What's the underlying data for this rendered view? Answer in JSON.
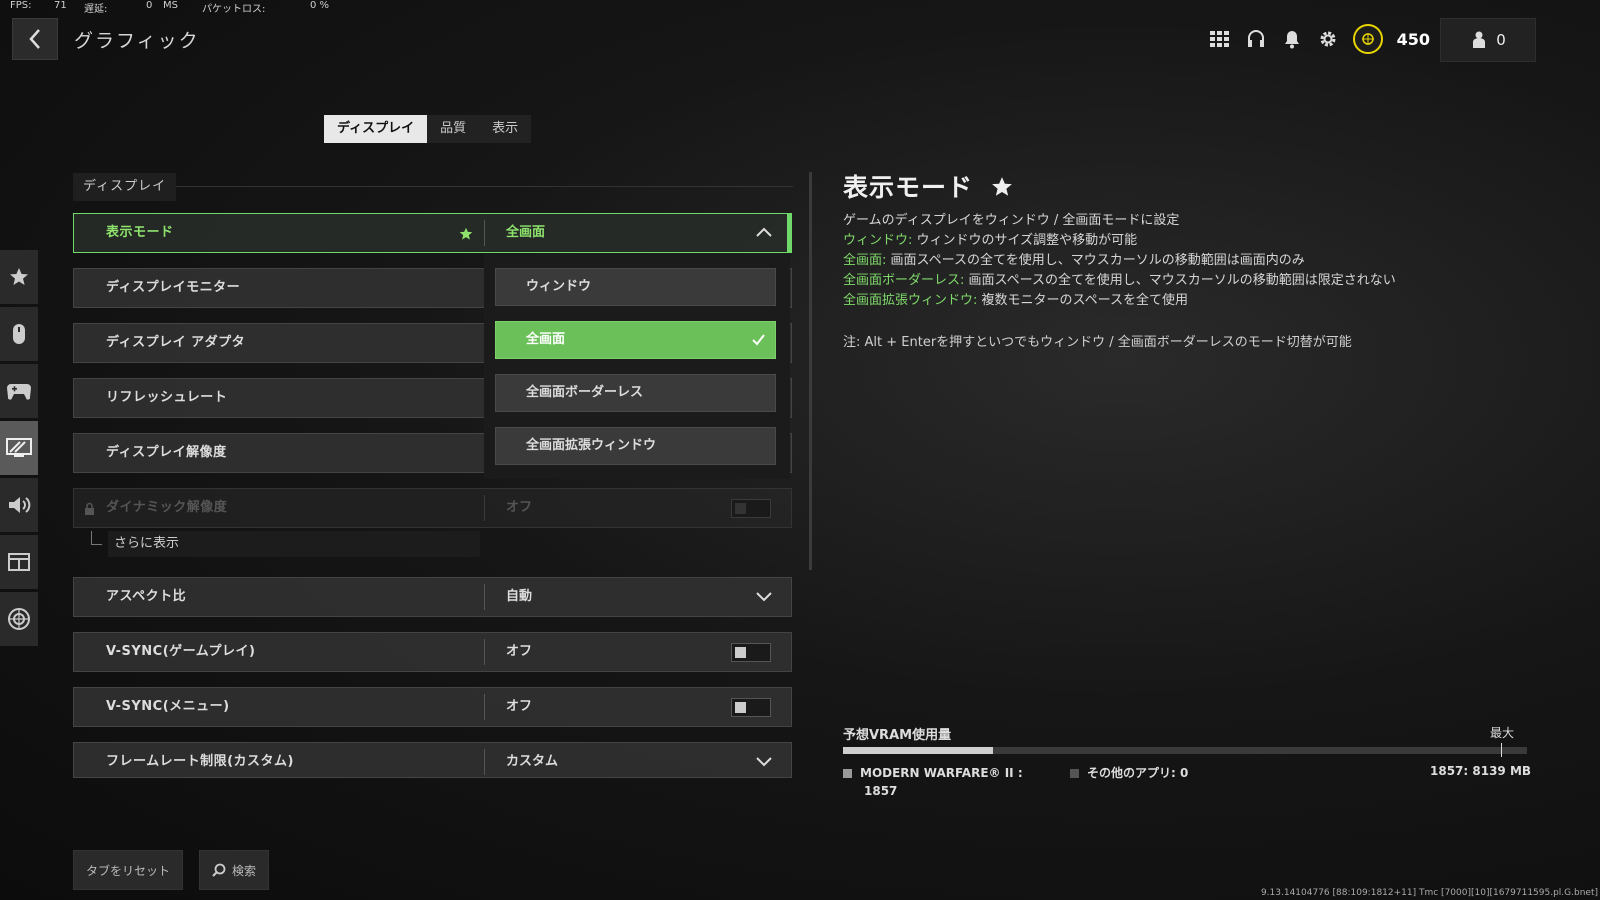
{
  "stats": {
    "fps_label": "FPS:",
    "fps_value": "71",
    "latency_label": "遅延:",
    "latency_value": "0",
    "latency_unit": "MS",
    "loss_label": "パケットロス:",
    "loss_value": "0 %"
  },
  "header": {
    "title": "グラフィック",
    "cp": "450",
    "friends": "0"
  },
  "tabs": [
    {
      "label": "ディスプレイ"
    },
    {
      "label": "品質"
    },
    {
      "label": "表示"
    }
  ],
  "section": {
    "label": "ディスプレイ"
  },
  "rows": [
    {
      "label": "表示モード",
      "value": "全画面"
    },
    {
      "label": "ディスプレイモニター",
      "value": ""
    },
    {
      "label": "ディスプレイ アダプタ",
      "value": ""
    },
    {
      "label": "リフレッシュレート",
      "value": ""
    },
    {
      "label": "ディスプレイ解像度",
      "value": ""
    },
    {
      "label": "ダイナミック解像度",
      "value": "オフ"
    },
    {
      "label": "アスペクト比",
      "value": "自動"
    },
    {
      "label": "V-SYNC(ゲームプレイ)",
      "value": "オフ"
    },
    {
      "label": "V-SYNC(メニュー)",
      "value": "オフ"
    },
    {
      "label": "フレームレート制限(カスタム)",
      "value": "カスタム"
    }
  ],
  "more": {
    "label": "さらに表示"
  },
  "dropdown": {
    "options": [
      "ウィンドウ",
      "全画面",
      "全画面ボーダーレス",
      "全画面拡張ウィンドウ"
    ],
    "selected": "全画面"
  },
  "detail": {
    "title": "表示モード",
    "line1": "ゲームのディスプレイをウィンドウ / 全画面モードに設定",
    "items": [
      {
        "term": "ウィンドウ:",
        "text": " ウィンドウのサイズ調整や移動が可能"
      },
      {
        "term": "全画面:",
        "text": " 画面スペースの全てを使用し、マウスカーソルの移動範囲は画面内のみ"
      },
      {
        "term": "全画面ボーダーレス:",
        "text": " 画面スペースの全てを使用し、マウスカーソルの移動範囲は限定されない"
      },
      {
        "term": "全画面拡張ウィンドウ:",
        "text": " 複数モニターのスペースを全て使用"
      }
    ],
    "note": "注: Alt + Enterを押すといつでもウィンドウ / 全画面ボーダーレスのモード切替が可能"
  },
  "vram": {
    "label": "予想VRAM使用量",
    "max_label": "最大",
    "game_label": "MODERN WARFARE® II :",
    "game_value": "1857",
    "other_label": "その他のアプリ: 0",
    "total": "1857: 8139 MB",
    "used_mb": 1857,
    "max_mb": 8139
  },
  "footer": {
    "reset": "タブをリセット",
    "search": "検索",
    "version": "9.13.14104776 [88:109:1812+11] Tmc [7000][10][1679711595.pl.G.bnet]"
  },
  "colors": {
    "accent": "#6fd96a",
    "selected_option": "#6cc05a",
    "coin": "#e8d400"
  }
}
